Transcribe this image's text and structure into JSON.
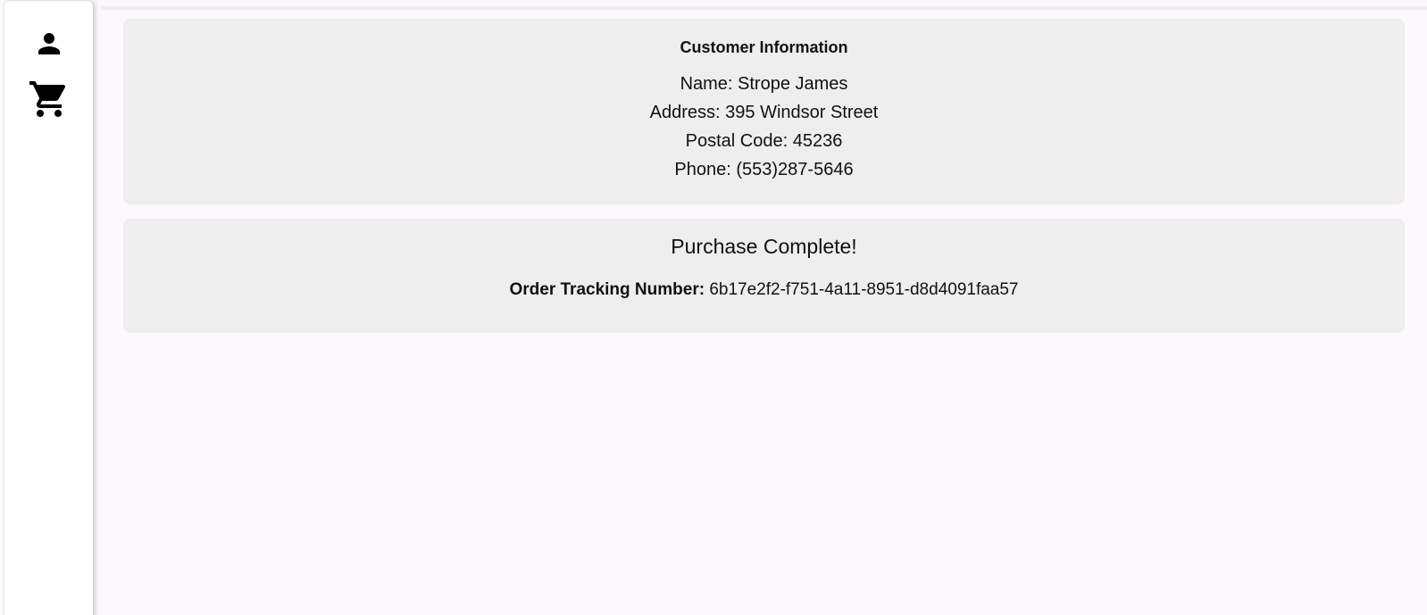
{
  "nav": {
    "items": [
      {
        "icon": "person-icon"
      },
      {
        "icon": "shopping-cart-icon"
      }
    ]
  },
  "customer": {
    "title": "Customer Information",
    "name_line": "Name: Strope James",
    "address_line": "Address: 395 Windsor Street",
    "postal_line": "Postal Code: 45236",
    "phone_line": "Phone: (553)287-5646"
  },
  "purchase": {
    "title": "Purchase Complete!",
    "tracking_label": "Order Tracking Number:",
    "tracking_number": "6b17e2f2-f751-4a11-8951-d8d4091faa57"
  },
  "colors": {
    "background": "#fdf8fd",
    "card": "#eeeeee",
    "rail": "#ffffff"
  }
}
